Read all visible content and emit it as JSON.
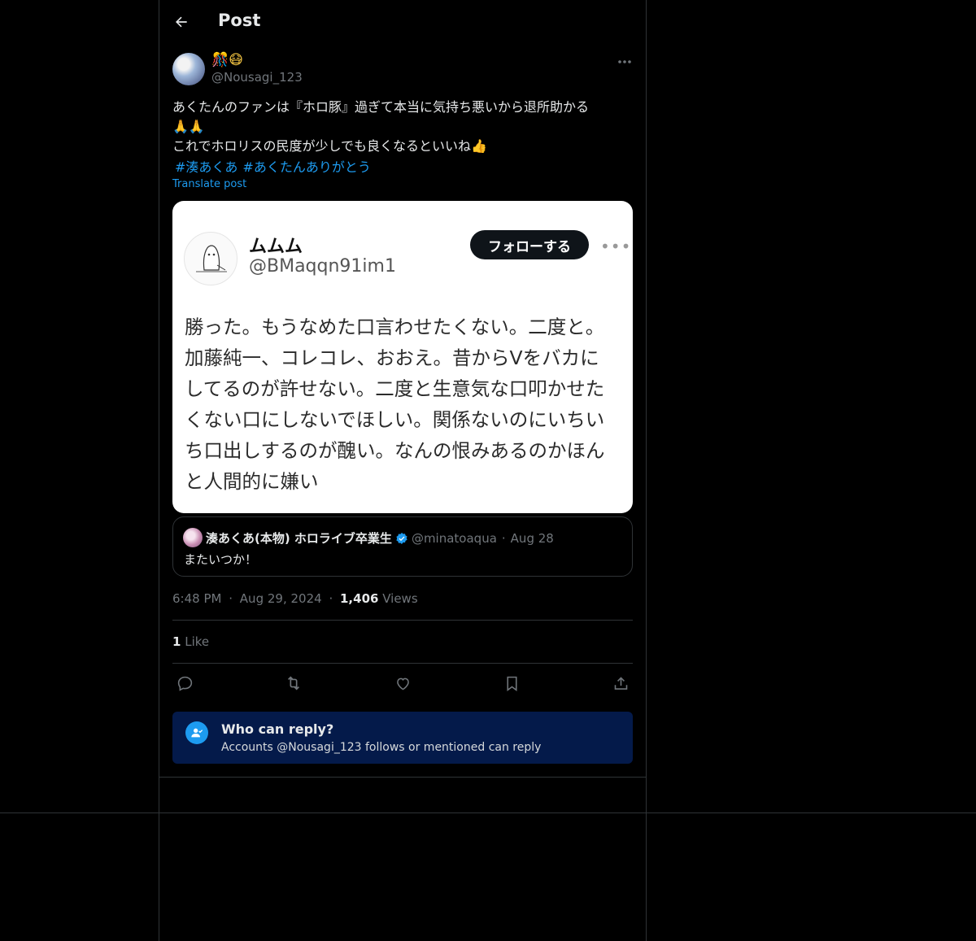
{
  "header": {
    "title": "Post"
  },
  "post": {
    "author_name_emoji": "🎊😷",
    "author_handle": "@Nousagi_123",
    "text_lines": [
      "あくたんのファンは『ホロ豚』過ぎて本当に気持ち悪いから退所助かる",
      "🙏🙏",
      "これでホロリスの民度が少しでも良くなるといいね👍"
    ],
    "hashtags": [
      "#湊あくあ",
      "#あくたんありがとう"
    ],
    "translate_label": "Translate post",
    "time": "6:48 PM",
    "date": "Aug 29, 2024",
    "views_count": "1,406",
    "views_label": "Views",
    "likes_count": "1",
    "likes_label": "Like"
  },
  "embedded_image": {
    "name": "ムムム",
    "handle": "@BMaqqn91im1",
    "follow_label": "フォローする",
    "more": "•••",
    "text_lines": [
      "勝った。もうなめた口言わせたくない。二度と。",
      "加藤純一、コレコレ、おおえ。昔からVをバカに",
      "してるのが許せない。二度と生意気な口叩かせた",
      "くない口にしないでほしい。関係ないのにいちい",
      "ち口出しするのが醜い。なんの恨みあるのかほん",
      "と人間的に嫌い"
    ]
  },
  "quoted_post": {
    "name": "湊あくあ(本物) ホロライブ卒業生",
    "handle": "@minatoaqua",
    "separator": "·",
    "date": "Aug 28",
    "text": "またいつか！"
  },
  "meta_separator": "·",
  "reply_restriction": {
    "title": "Who can reply?",
    "subtitle": "Accounts @Nousagi_123 follows or mentioned can reply"
  },
  "colors": {
    "background": "#000000",
    "accent": "#1d9bf0",
    "muted": "#71767b",
    "reply_box": "#041a4a"
  }
}
